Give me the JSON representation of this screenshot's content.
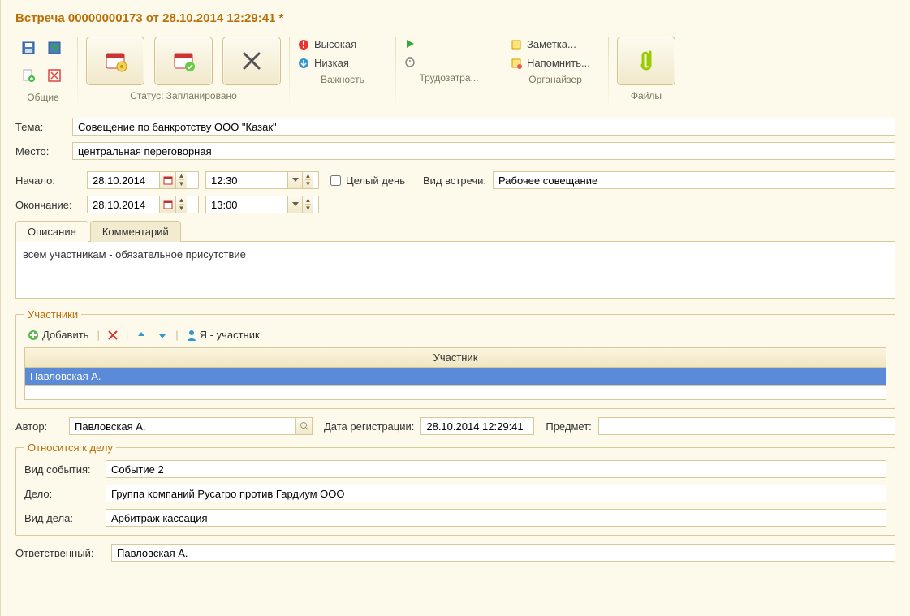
{
  "title": "Встреча 00000000173 от 28.10.2014 12:29:41 *",
  "ribbon": {
    "common_caption": "Общие",
    "status_caption": "Статус: Запланировано",
    "importance_caption": "Важность",
    "importance_high": "Высокая",
    "importance_low": "Низкая",
    "effort_caption": "Трудозатра...",
    "organizer_caption": "Органайзер",
    "organizer_note": "Заметка...",
    "organizer_remind": "Напомнить...",
    "files_caption": "Файлы"
  },
  "form": {
    "subject_label": "Тема:",
    "subject_value": "Совещение по банкротству ООО \"Казак\"",
    "place_label": "Место:",
    "place_value": "центральная переговорная",
    "start_label": "Начало:",
    "end_label": "Окончание:",
    "start_date": "28.10.2014",
    "start_time": "12:30",
    "end_date": "28.10.2014",
    "end_time": "13:00",
    "allday_label": "Целый день",
    "type_label": "Вид встречи:",
    "type_value": "Рабочее совещание",
    "tab_desc": "Описание",
    "tab_comment": "Комментарий",
    "description": "всем участникам - обязательное присутствие"
  },
  "participants": {
    "legend": "Участники",
    "add": "Добавить",
    "me": "Я - участник",
    "col": "Участник",
    "row1": "Павловская А."
  },
  "meta": {
    "author_label": "Автор:",
    "author_value": "Павловская А.",
    "regdate_label": "Дата регистрации:",
    "regdate_value": "28.10.2014 12:29:41",
    "subject2_label": "Предмет:",
    "subject2_value": ""
  },
  "case": {
    "legend": "Относится к делу",
    "event_type_label": "Вид события:",
    "event_type_value": "Событие 2",
    "case_label": "Дело:",
    "case_value": "Группа компаний Русагро против Гардиум ООО",
    "case_type_label": "Вид дела:",
    "case_type_value": "Арбитраж кассация"
  },
  "responsible": {
    "label": "Ответственный:",
    "value": "Павловская А."
  }
}
